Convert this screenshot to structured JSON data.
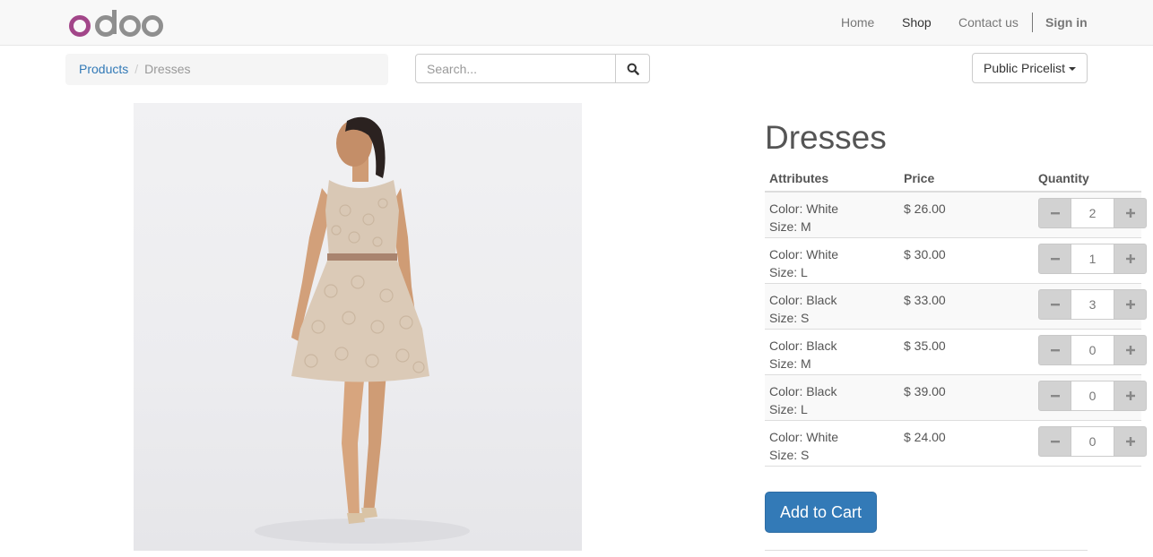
{
  "navbar": {
    "logo_text": "odoo",
    "links": [
      {
        "label": "Home"
      },
      {
        "label": "Shop"
      },
      {
        "label": "Contact us"
      }
    ],
    "signin_label": "Sign in"
  },
  "breadcrumb": {
    "items": [
      "Products",
      "Dresses"
    ],
    "separator": "/"
  },
  "search": {
    "placeholder": "Search...",
    "value": "",
    "icon": "search-icon"
  },
  "pricelist": {
    "label": "Public Pricelist",
    "icon": "caret-down-icon"
  },
  "product": {
    "title": "Dresses",
    "table_headers": {
      "attributes": "Attributes",
      "price": "Price",
      "quantity": "Quantity"
    },
    "variants": [
      {
        "color": "Color: White",
        "size": "Size: M",
        "price": "$ 26.00",
        "quantity": "2"
      },
      {
        "color": "Color: White",
        "size": "Size: L",
        "price": "$ 30.00",
        "quantity": "1"
      },
      {
        "color": "Color: Black",
        "size": "Size: S",
        "price": "$ 33.00",
        "quantity": "3"
      },
      {
        "color": "Color: Black",
        "size": "Size: M",
        "price": "$ 35.00",
        "quantity": "0"
      },
      {
        "color": "Color: Black",
        "size": "Size: L",
        "price": "$ 39.00",
        "quantity": "0"
      },
      {
        "color": "Color: White",
        "size": "Size: S",
        "price": "$ 24.00",
        "quantity": "0"
      }
    ],
    "add_to_cart_label": "Add to Cart"
  },
  "colors": {
    "brand_purple": "#a24689",
    "brand_gray": "#8f8f8f",
    "link_blue": "#337ab7",
    "button_blue": "#337ab7"
  }
}
